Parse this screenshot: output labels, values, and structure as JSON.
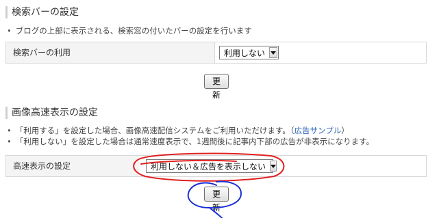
{
  "search_bar_section": {
    "title": "検索バーの設定",
    "description": "ブログの上部に表示される、検索窓の付いたバーの設定を行います",
    "row": {
      "label": "検索バーの利用",
      "selected": "利用しない"
    },
    "update_button": "更新"
  },
  "fast_display_section": {
    "title": "画像高速表示の設定",
    "bullets": [
      {
        "text": "「利用する」を設定した場合、画像高速配信システムをご利用いただけます。（",
        "link": "広告サンプル",
        "suffix": "）"
      },
      {
        "text": "「利用しない」を設定した場合は通常速度表示で、1週間後に記事内下部の広告が非表示になります。"
      }
    ],
    "row": {
      "label": "高速表示の設定",
      "selected": "利用しない＆広告を表示しない"
    },
    "update_button": "更新"
  },
  "annotations": {
    "red_circle_color": "#e02020",
    "blue_circle_color": "#1a2fd6"
  }
}
